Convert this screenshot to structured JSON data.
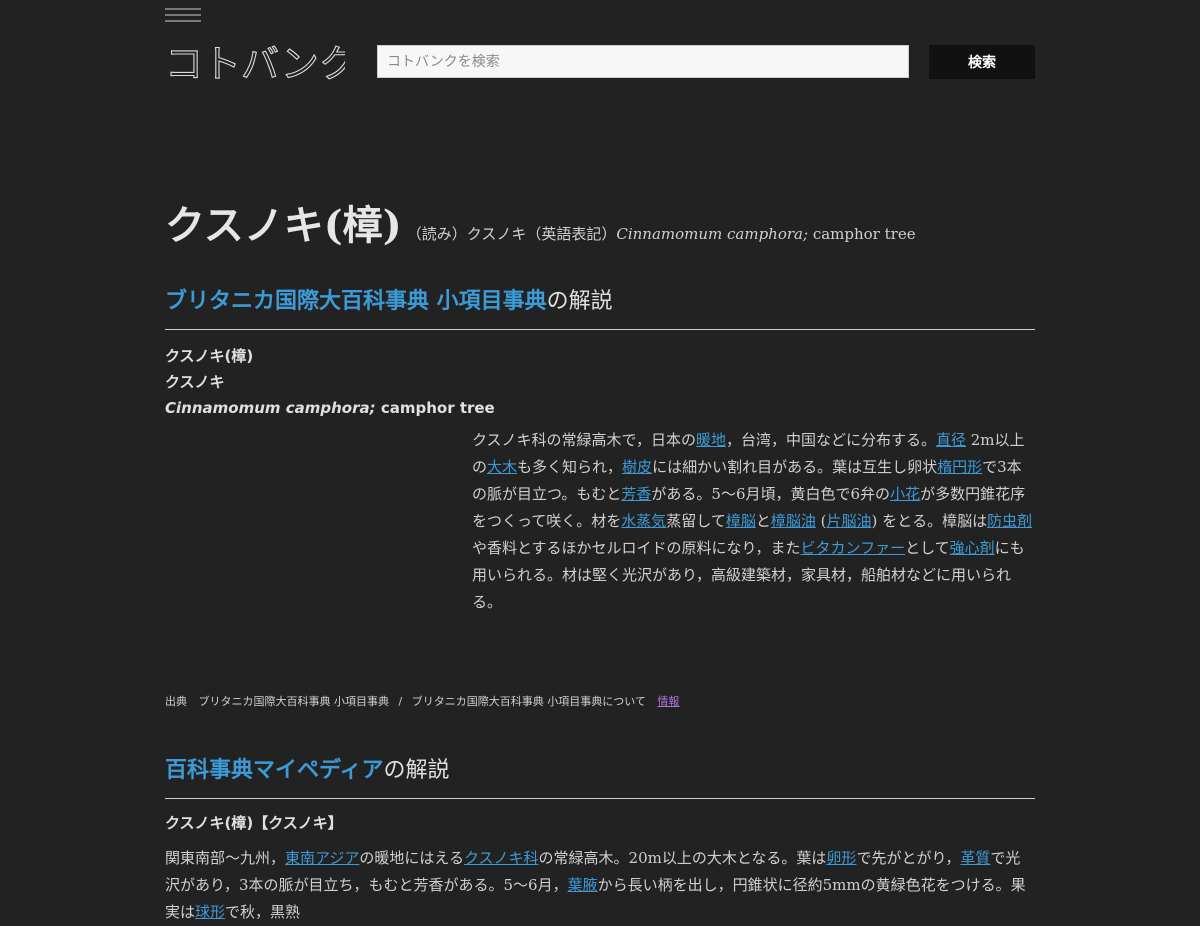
{
  "header": {
    "logo_text": "コトバンク",
    "search_placeholder": "コトバンクを検索",
    "search_button": "検索"
  },
  "entry": {
    "title": "クスノキ(樟)",
    "reading_label": "（読み）",
    "reading": "クスノキ",
    "english_label": "（英語表記）",
    "english_sci": "Cinnamomum camphora;",
    "english_common": " camphor tree"
  },
  "section1": {
    "dict_name": "ブリタニカ国際大百科事典 小項目事典",
    "suffix": "の解説",
    "term_lines": [
      "クスノキ(樟)",
      "クスノキ"
    ],
    "term_sci": "Cinnamomum camphora;",
    "term_common": " camphor tree",
    "body": [
      {
        "t": "クスノキ科の常緑高木で，日本の"
      },
      {
        "t": "暖地",
        "link": true
      },
      {
        "t": "，台湾，中国などに分布する。"
      },
      {
        "t": "直径",
        "link": true
      },
      {
        "t": " 2m以上の"
      },
      {
        "t": "大木",
        "link": true
      },
      {
        "t": "も多く知られ，"
      },
      {
        "t": "樹皮",
        "link": true
      },
      {
        "t": "には細かい割れ目がある。葉は互生し卵状"
      },
      {
        "t": "楕円形",
        "link": true
      },
      {
        "t": "で3本の脈が目立つ。もむと"
      },
      {
        "t": "芳香",
        "link": true
      },
      {
        "t": "がある。5～6月頃，黄白色で6弁の"
      },
      {
        "t": "小花",
        "link": true
      },
      {
        "t": "が多数円錐花序をつくって咲く。材を"
      },
      {
        "t": "水蒸気",
        "link": true
      },
      {
        "t": "蒸留して"
      },
      {
        "t": "樟脳",
        "link": true
      },
      {
        "t": "と"
      },
      {
        "t": "樟脳油",
        "link": true
      },
      {
        "t": " ("
      },
      {
        "t": "片脳油",
        "link": true
      },
      {
        "t": ") をとる。樟脳は"
      },
      {
        "t": "防虫剤",
        "link": true
      },
      {
        "t": "や香料とするほかセルロイドの原料になり，また"
      },
      {
        "t": "ビタカンファー",
        "link": true
      },
      {
        "t": "として"
      },
      {
        "t": "強心剤",
        "link": true
      },
      {
        "t": "にも用いられる。材は堅く光沢があり，高級建築材，家具材，船舶材などに用いられる。"
      }
    ],
    "source_label": "出典",
    "source_name": "ブリタニカ国際大百科事典 小項目事典",
    "source_sep": "/",
    "source_about": "ブリタニカ国際大百科事典 小項目事典について",
    "source_info": "情報"
  },
  "section2": {
    "dict_name": "百科事典マイペディア",
    "suffix": "の解説",
    "term": "クスノキ(樟)【クスノキ】",
    "body": [
      {
        "t": "関東南部～九州，"
      },
      {
        "t": "東南アジア",
        "link": true
      },
      {
        "t": "の暖地にはえる"
      },
      {
        "t": "クスノキ科",
        "link": true
      },
      {
        "t": "の常緑高木。20m以上の大木となる。葉は"
      },
      {
        "t": "卵形",
        "link": true
      },
      {
        "t": "で先がとがり，"
      },
      {
        "t": "革質",
        "link": true
      },
      {
        "t": "で光沢があり，3本の脈が目立ち，もむと芳香がある。5～6月，"
      },
      {
        "t": "葉腋",
        "link": true
      },
      {
        "t": "から長い柄を出し，円錐状に径約5mmの黄緑色花をつける。果実は"
      },
      {
        "t": "球形",
        "link": true
      },
      {
        "t": "で秋，黒熟"
      }
    ]
  },
  "colors": {
    "background": "#222222",
    "link": "#3c9ad6",
    "visited_link": "#a978d8"
  }
}
